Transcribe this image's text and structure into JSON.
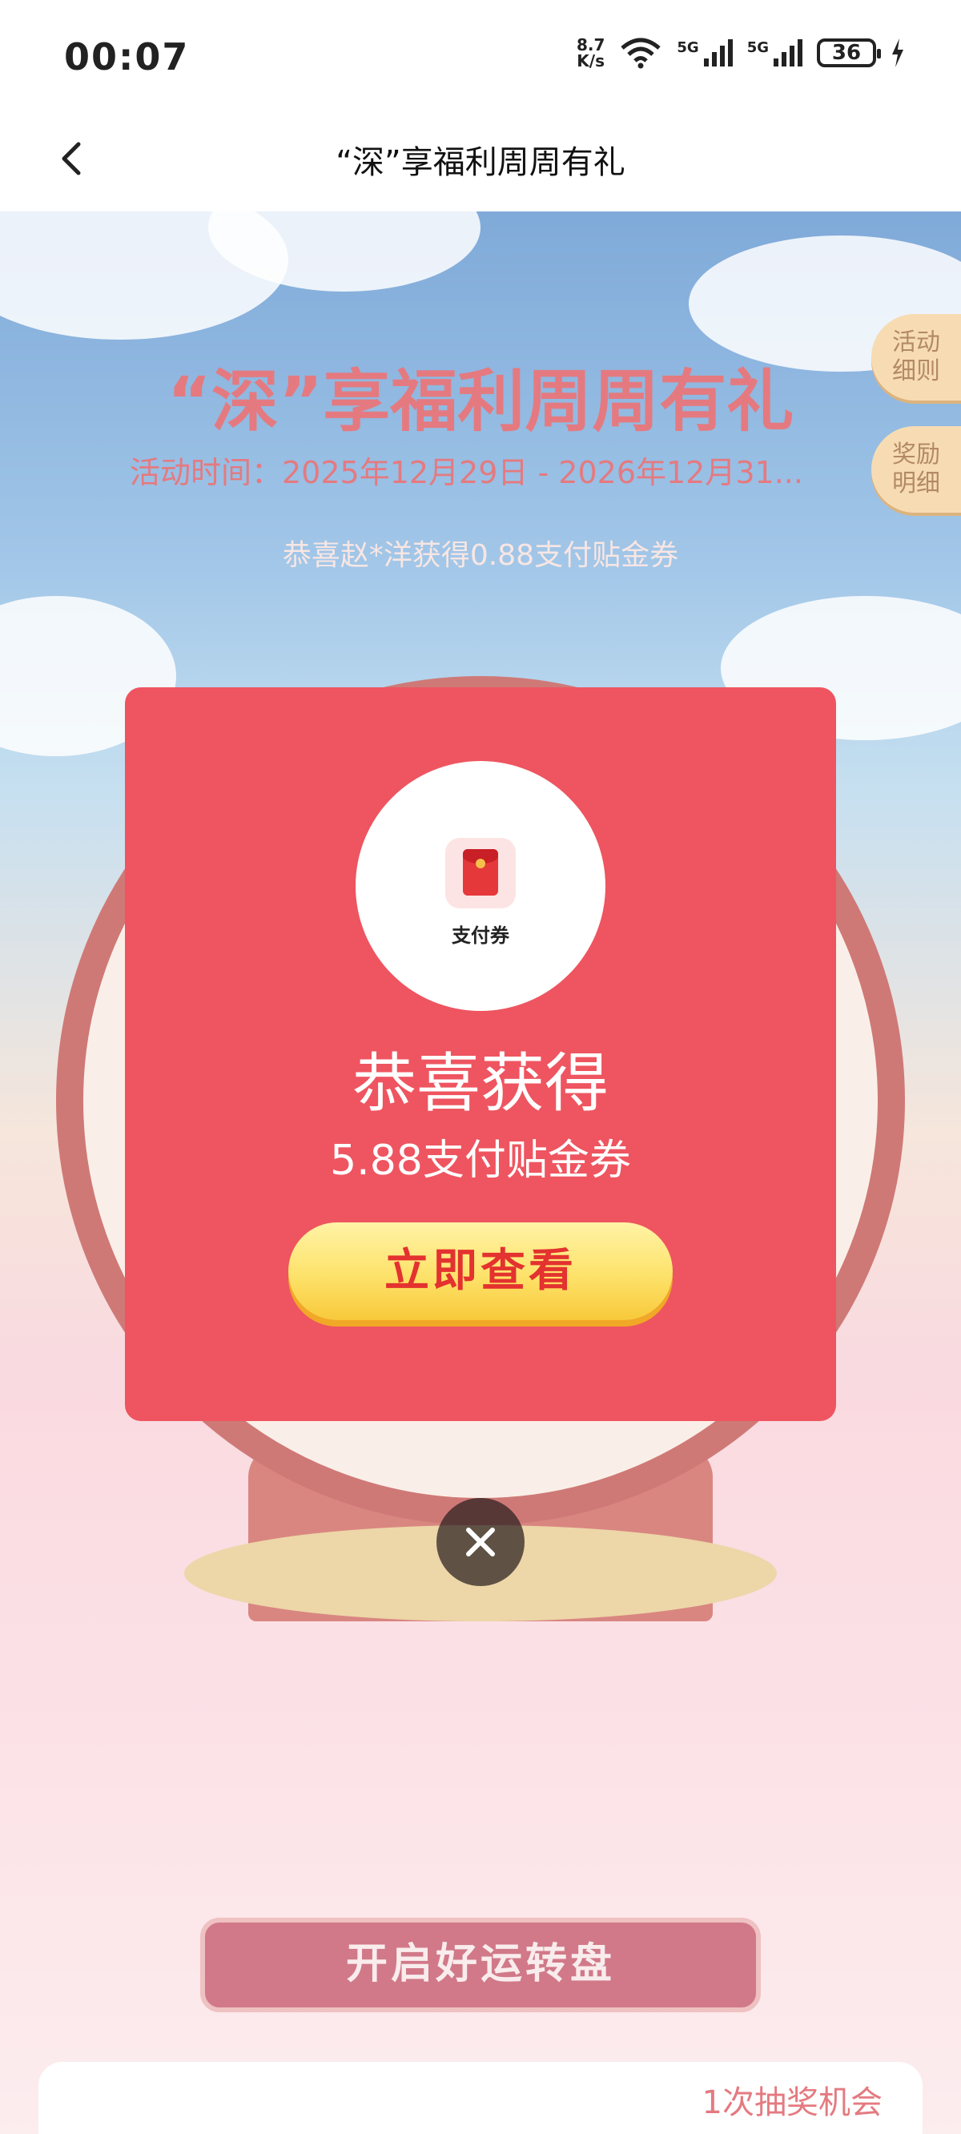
{
  "status_bar": {
    "time": "00:07",
    "net_speed_value": "8.7",
    "net_speed_unit": "K/s",
    "signal1_label": "5G",
    "signal2_label": "5G",
    "battery": "36"
  },
  "nav": {
    "title": "“深”享福利周周有礼"
  },
  "page": {
    "headline": "“深”享福利周周有礼",
    "period": "活动时间：2025年12月29日 - 2026年12月31...",
    "ticker": "恭喜赵*洋获得0.88支付贴金券",
    "side_rules": "活动细则",
    "side_rewards": "奖励明细",
    "spin_banner": "开启好运转盘",
    "chance_text": "1次抽奖机会"
  },
  "modal": {
    "coupon_label": "支付券",
    "congrats": "恭喜获得",
    "prize_name": "5.88支付贴金券",
    "view_button": "立即查看"
  },
  "colors": {
    "modal_bg": "#ee5560",
    "title_red": "#d6333d",
    "button_yellow": "#fde26a"
  }
}
